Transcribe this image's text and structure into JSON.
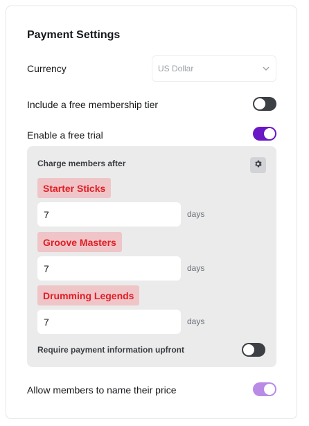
{
  "title": "Payment Settings",
  "currency": {
    "label": "Currency",
    "selected": "US Dollar"
  },
  "free_membership": {
    "label": "Include a free membership tier",
    "enabled": false
  },
  "free_trial": {
    "label": "Enable a free trial",
    "enabled": true,
    "panel": {
      "heading": "Charge members after",
      "tiers": [
        {
          "name": "Starter Sticks",
          "days": "7",
          "unit": "days"
        },
        {
          "name": "Groove Masters",
          "days": "7",
          "unit": "days"
        },
        {
          "name": "Drumming Legends",
          "days": "7",
          "unit": "days"
        }
      ],
      "require_payment": {
        "label": "Require payment information upfront",
        "enabled": false
      }
    }
  },
  "name_price": {
    "label": "Allow members to name their price",
    "enabled": true
  },
  "colors": {
    "toggle_on": "#6a17c5",
    "toggle_on_light": "#b98ae6",
    "toggle_off": "#3c3f43",
    "tier_tag_bg": "#efc5c8",
    "tier_tag_text": "#e01d25"
  }
}
